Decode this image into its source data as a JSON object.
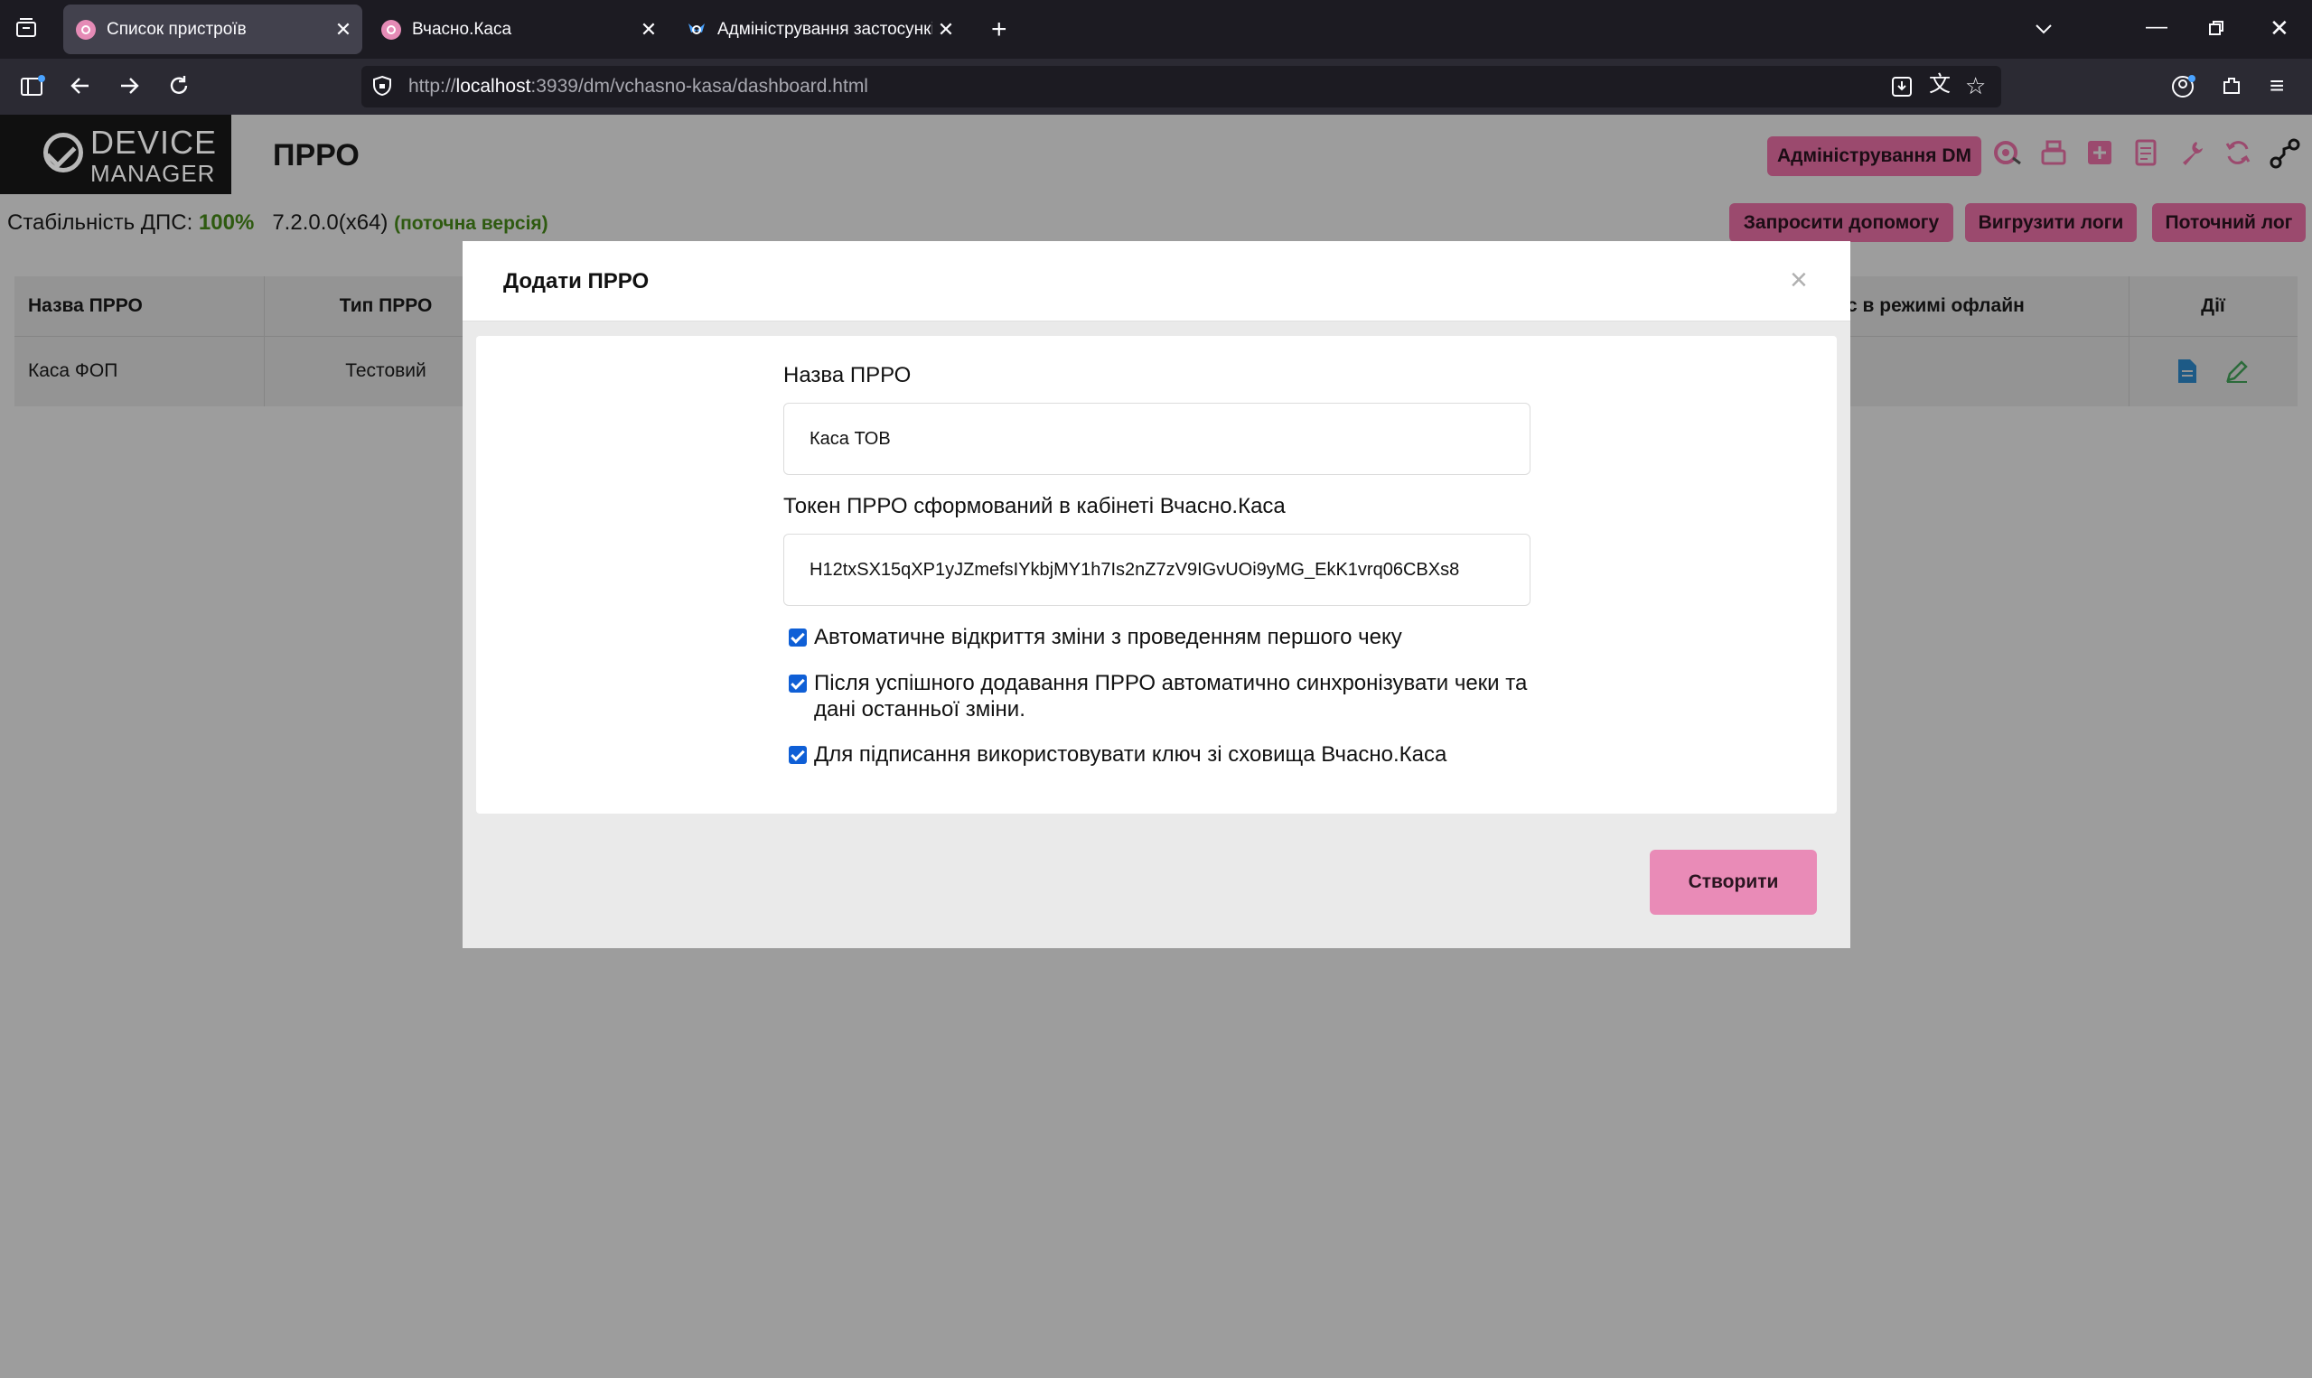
{
  "browser": {
    "tabs": [
      {
        "title": "Список пристроїв",
        "active": true
      },
      {
        "title": "Вчасно.Каса",
        "active": false
      },
      {
        "title": "Адміністрування застосунків |",
        "active": false
      }
    ],
    "url_prefix": "http://",
    "url_host": "localhost",
    "url_rest": ":3939/dm/vchasno-kasa/dashboard.html"
  },
  "app": {
    "logo_line1": "DEVICE",
    "logo_line2": "MANAGER",
    "page_title": "ПРРО",
    "admin_button": "Адміністрування DM",
    "status_label": "Стабільність ДПС:",
    "status_value": "100%",
    "version": "7.2.0.0(x64)",
    "version_note": "(поточна версія)",
    "buttons": {
      "help": "Запросити допомогу",
      "export_logs": "Вигрузити логи",
      "current_log": "Поточний лог"
    },
    "table": {
      "headers": [
        "Назва ПРРО",
        "Тип ПРРО",
        "с в режимі офлайн",
        "Дії"
      ],
      "rows": [
        {
          "name": "Каса ФОП",
          "type": "Тестовий"
        }
      ]
    }
  },
  "modal": {
    "title": "Додати ПРРО",
    "close": "×",
    "name_label": "Назва ПРРО",
    "name_value": "Каса ТОВ",
    "token_label": "Токен ПРРО сформований в кабінеті Вчасно.Каса",
    "token_value": "H12txSX15qXP1yJZmefsIYkbjMY1h7Is2nZ7zV9IGvUOi9yMG_EkK1vrq06CBXs8",
    "checkboxes": [
      {
        "label": "Автоматичне відкриття зміни з проведенням першого чеку",
        "checked": true
      },
      {
        "label": "Після успішного додавання ПРРО автоматично синхронізувати чеки та дані останньої зміни.",
        "checked": true
      },
      {
        "label": "Для підписання використовувати ключ зі сховища Вчасно.Каса",
        "checked": true
      }
    ],
    "submit": "Створити"
  },
  "colors": {
    "accent_pink": "#e98bb7",
    "overlay_grey": "#9d9d9d",
    "checkbox_blue": "#0f5fd6",
    "success_green": "#2e5a10"
  }
}
